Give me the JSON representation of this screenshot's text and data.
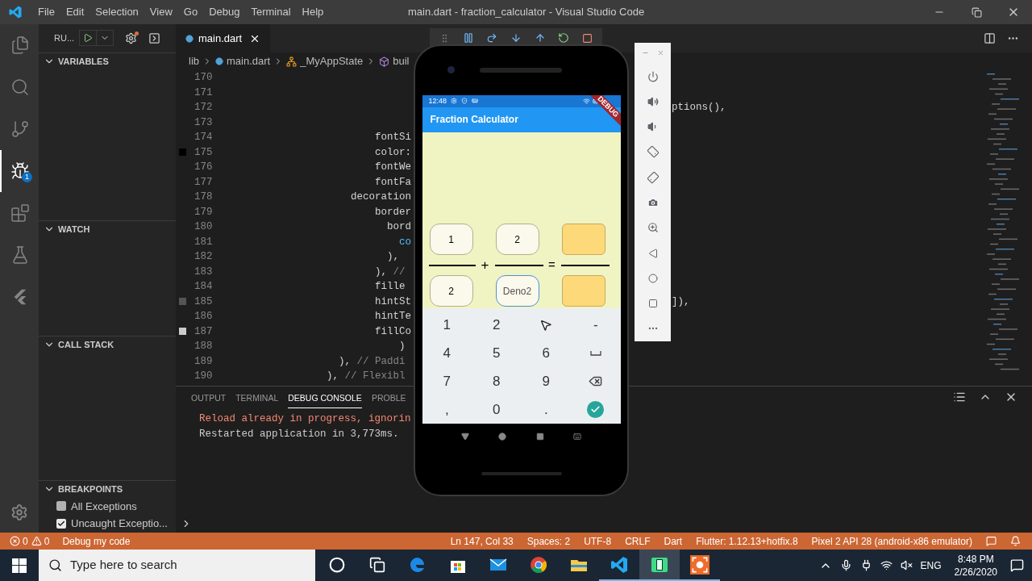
{
  "window": {
    "title": "main.dart - fraction_calculator - Visual Studio Code"
  },
  "menu": [
    "File",
    "Edit",
    "Selection",
    "View",
    "Go",
    "Debug",
    "Terminal",
    "Help"
  ],
  "activity_bar": [
    {
      "kind": "files",
      "selected": false
    },
    {
      "kind": "search",
      "selected": false
    },
    {
      "kind": "source_control",
      "selected": false
    },
    {
      "kind": "debug",
      "selected": true,
      "badge": "1"
    },
    {
      "kind": "extensions",
      "selected": false
    },
    {
      "kind": "test",
      "selected": false
    },
    {
      "kind": "flutter",
      "selected": false
    }
  ],
  "debug_sidebar": {
    "run_label": "RU...",
    "sections": [
      {
        "title": "VARIABLES",
        "expanded": true
      },
      {
        "title": "WATCH",
        "expanded": true
      },
      {
        "title": "CALL STACK",
        "expanded": true
      },
      {
        "title": "BREAKPOINTS",
        "expanded": true
      }
    ],
    "breakpoints": [
      {
        "label": "All Exceptions",
        "checked": false
      },
      {
        "label": "Uncaught Exceptio...",
        "checked": true
      }
    ]
  },
  "tabs": [
    {
      "label": "main.dart",
      "selected": true
    }
  ],
  "breadcrumb": [
    {
      "label": "lib",
      "kind": "folder"
    },
    {
      "label": "main.dart",
      "kind": "file"
    },
    {
      "label": "_MyAppState",
      "kind": "class"
    },
    {
      "label": "buil",
      "kind": "method"
    }
  ],
  "code_lines": [
    {
      "number": "170"
    },
    {
      "number": "171"
    },
    {
      "number": "172",
      "tail": "ptions(),"
    },
    {
      "number": "173"
    },
    {
      "number": "174",
      "parts": [
        {
          "text": "                        fontSi",
          "kind": "plain"
        }
      ]
    },
    {
      "number": "175",
      "color": "#000000",
      "parts": [
        {
          "text": "                        color:",
          "kind": "plain"
        }
      ]
    },
    {
      "number": "176",
      "parts": [
        {
          "text": "                        fontWe",
          "kind": "plain"
        }
      ]
    },
    {
      "number": "177",
      "parts": [
        {
          "text": "                        fontFa",
          "kind": "plain"
        }
      ]
    },
    {
      "number": "178",
      "parts": [
        {
          "text": "                    decoration",
          "kind": "plain"
        }
      ]
    },
    {
      "number": "179",
      "parts": [
        {
          "text": "                        border",
          "kind": "plain"
        }
      ]
    },
    {
      "number": "180",
      "parts": [
        {
          "text": "                          bord",
          "kind": "plain"
        }
      ]
    },
    {
      "number": "181",
      "parts": [
        {
          "text": "                            co",
          "kind": "keyword"
        }
      ]
    },
    {
      "number": "182",
      "parts": [
        {
          "text": "                          ),",
          "kind": "plain"
        }
      ]
    },
    {
      "number": "183",
      "parts": [
        {
          "text": "                        ), ",
          "kind": "plain"
        },
        {
          "text": "//",
          "kind": "comment"
        }
      ]
    },
    {
      "number": "184",
      "parts": [
        {
          "text": "                        fille",
          "kind": "plain"
        }
      ]
    },
    {
      "number": "185",
      "color": "#555555",
      "tail": "]),",
      "parts": [
        {
          "text": "                        hintSt",
          "kind": "plain"
        }
      ]
    },
    {
      "number": "186",
      "parts": [
        {
          "text": "                        hintTe",
          "kind": "plain"
        }
      ]
    },
    {
      "number": "187",
      "color": "#cccccc",
      "parts": [
        {
          "text": "                        fillCo",
          "kind": "plain"
        }
      ]
    },
    {
      "number": "188",
      "parts": [
        {
          "text": "                            )",
          "kind": "plain"
        }
      ]
    },
    {
      "number": "189",
      "parts": [
        {
          "text": "                  ), ",
          "kind": "plain"
        },
        {
          "text": "// Paddi",
          "kind": "comment"
        }
      ]
    },
    {
      "number": "190",
      "parts": [
        {
          "text": "                ), ",
          "kind": "plain"
        },
        {
          "text": "// Flexibl",
          "kind": "comment"
        }
      ]
    }
  ],
  "panel": {
    "tabs": [
      {
        "label": "OUTPUT",
        "selected": false
      },
      {
        "label": "TERMINAL",
        "selected": false
      },
      {
        "label": "DEBUG CONSOLE",
        "selected": true
      },
      {
        "label": "PROBLE",
        "selected": false
      }
    ],
    "output": [
      {
        "text": "Reload already in progress, ignorin",
        "kind": "error"
      },
      {
        "text": "Restarted application in 3,773ms.",
        "kind": "info"
      }
    ]
  },
  "phone": {
    "time": "12:48",
    "debug_banner": "DEBUG",
    "app_title": "Fraction Calculator",
    "numerators": [
      {
        "kind": "input",
        "value": "1"
      },
      {
        "kind": "input",
        "value": "2"
      },
      {
        "kind": "result"
      }
    ],
    "operators": [
      "+",
      "="
    ],
    "denominators": [
      {
        "kind": "input",
        "value": "2"
      },
      {
        "kind": "input",
        "placeholder": "Deno2",
        "focused": true
      },
      {
        "kind": "result"
      }
    ],
    "keys": [
      {
        "kind": "char",
        "label": "1"
      },
      {
        "kind": "char",
        "label": "2"
      },
      {
        "kind": "pointer"
      },
      {
        "kind": "char",
        "label": "-"
      },
      {
        "kind": "char",
        "label": "4"
      },
      {
        "kind": "char",
        "label": "5"
      },
      {
        "kind": "char",
        "label": "6"
      },
      {
        "kind": "space"
      },
      {
        "kind": "char",
        "label": "7"
      },
      {
        "kind": "char",
        "label": "8"
      },
      {
        "kind": "char",
        "label": "9"
      },
      {
        "kind": "backspace"
      },
      {
        "kind": "char",
        "label": ","
      },
      {
        "kind": "char",
        "label": "0"
      },
      {
        "kind": "char",
        "label": "."
      },
      {
        "kind": "done"
      }
    ]
  },
  "emulator_tools": [
    {
      "kind": "power"
    },
    {
      "kind": "volume_up"
    },
    {
      "kind": "volume_down"
    },
    {
      "kind": "rotate_left"
    },
    {
      "kind": "rotate_right"
    },
    {
      "kind": "camera"
    },
    {
      "kind": "zoom"
    },
    {
      "kind": "back"
    },
    {
      "kind": "home"
    },
    {
      "kind": "overview"
    },
    {
      "kind": "more"
    }
  ],
  "status_bar": {
    "errors": "0",
    "warnings": "0",
    "launch": "Debug my code",
    "right": [
      "Ln 147, Col 33",
      "Spaces: 2",
      "UTF-8",
      "CRLF",
      "Dart",
      "Flutter: 1.12.13+hotfix.8",
      "Pixel 2 API 28 (android-x86 emulator)"
    ]
  },
  "taskbar": {
    "search_placeholder": "Type here to search",
    "apps": [
      {
        "kind": "cortana",
        "active": false
      },
      {
        "kind": "task_view",
        "active": false
      },
      {
        "kind": "edge",
        "active": false
      },
      {
        "kind": "store",
        "active": false
      },
      {
        "kind": "mail",
        "active": false
      },
      {
        "kind": "chrome",
        "active": false
      },
      {
        "kind": "explorer",
        "active": false
      },
      {
        "kind": "vscode",
        "active": true
      },
      {
        "kind": "emulator",
        "active": true
      },
      {
        "kind": "recorder",
        "active": true
      }
    ],
    "language": "ENG",
    "time": "8:48 PM",
    "date": "2/26/2020"
  }
}
